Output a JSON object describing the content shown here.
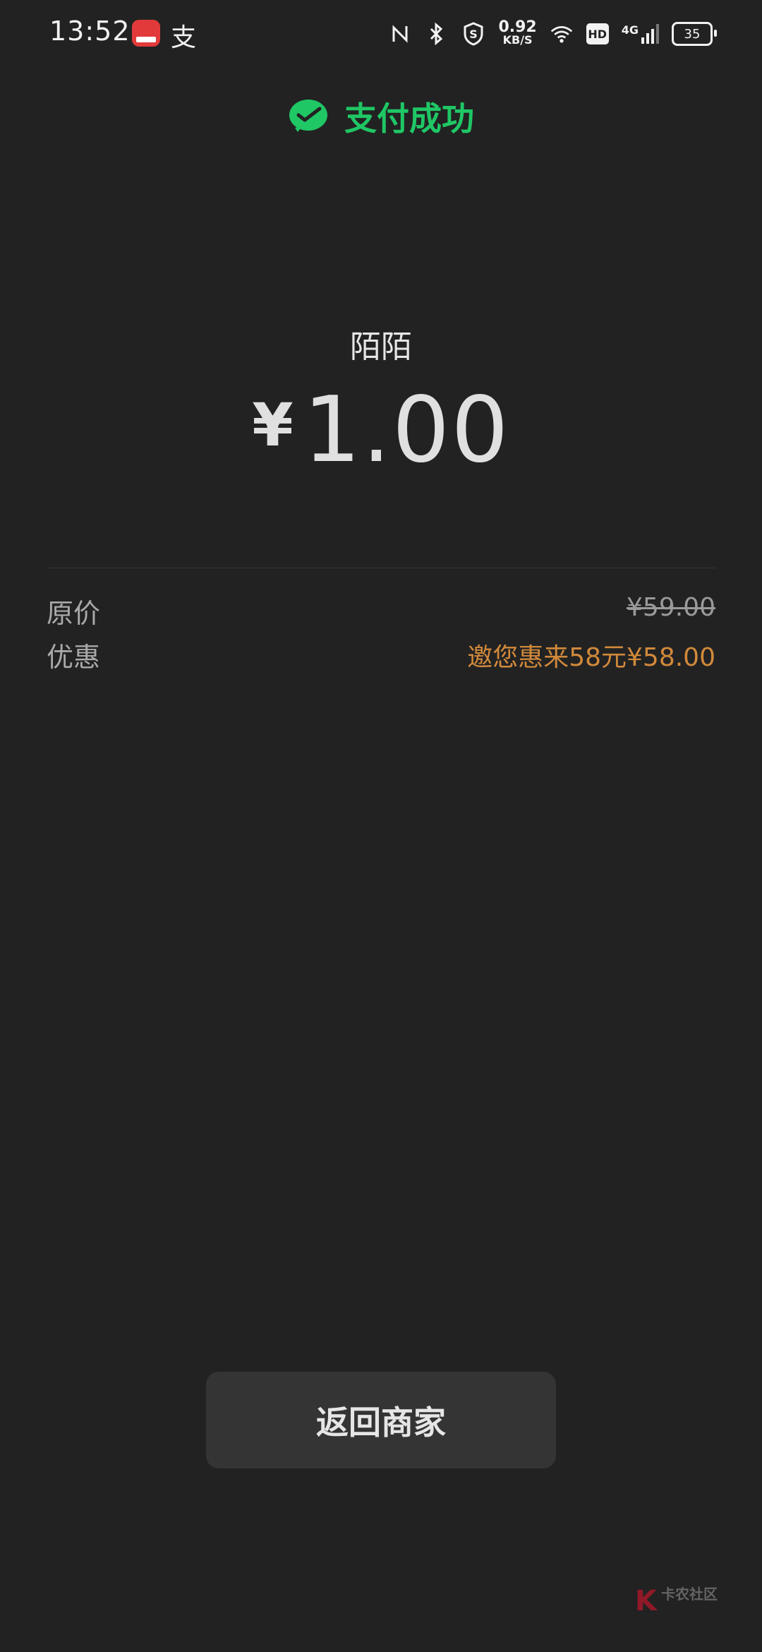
{
  "status_bar": {
    "time": "13:52",
    "app_icon_red_label": "云闪付",
    "alipay_glyph": "支",
    "speed_value": "0.92",
    "speed_unit": "KB/S",
    "hd_label": "HD",
    "network_label": "4G",
    "battery_level": "35"
  },
  "header": {
    "success_text": "支付成功",
    "brand_icon": "wechat-pay-icon",
    "accent_color": "#1fc765"
  },
  "payment": {
    "merchant_name": "陌陌",
    "currency_symbol": "¥",
    "amount": "1.00"
  },
  "details": [
    {
      "label": "原价",
      "value": "¥59.00"
    },
    {
      "label": "优惠",
      "value": "邀您惠来58元¥58.00"
    }
  ],
  "actions": {
    "back_label": "返回商家"
  },
  "watermark": {
    "logo_text": "K",
    "name": "卡农社区"
  },
  "colors": {
    "background": "#222222",
    "discount": "#d1893b",
    "button": "#343434"
  }
}
